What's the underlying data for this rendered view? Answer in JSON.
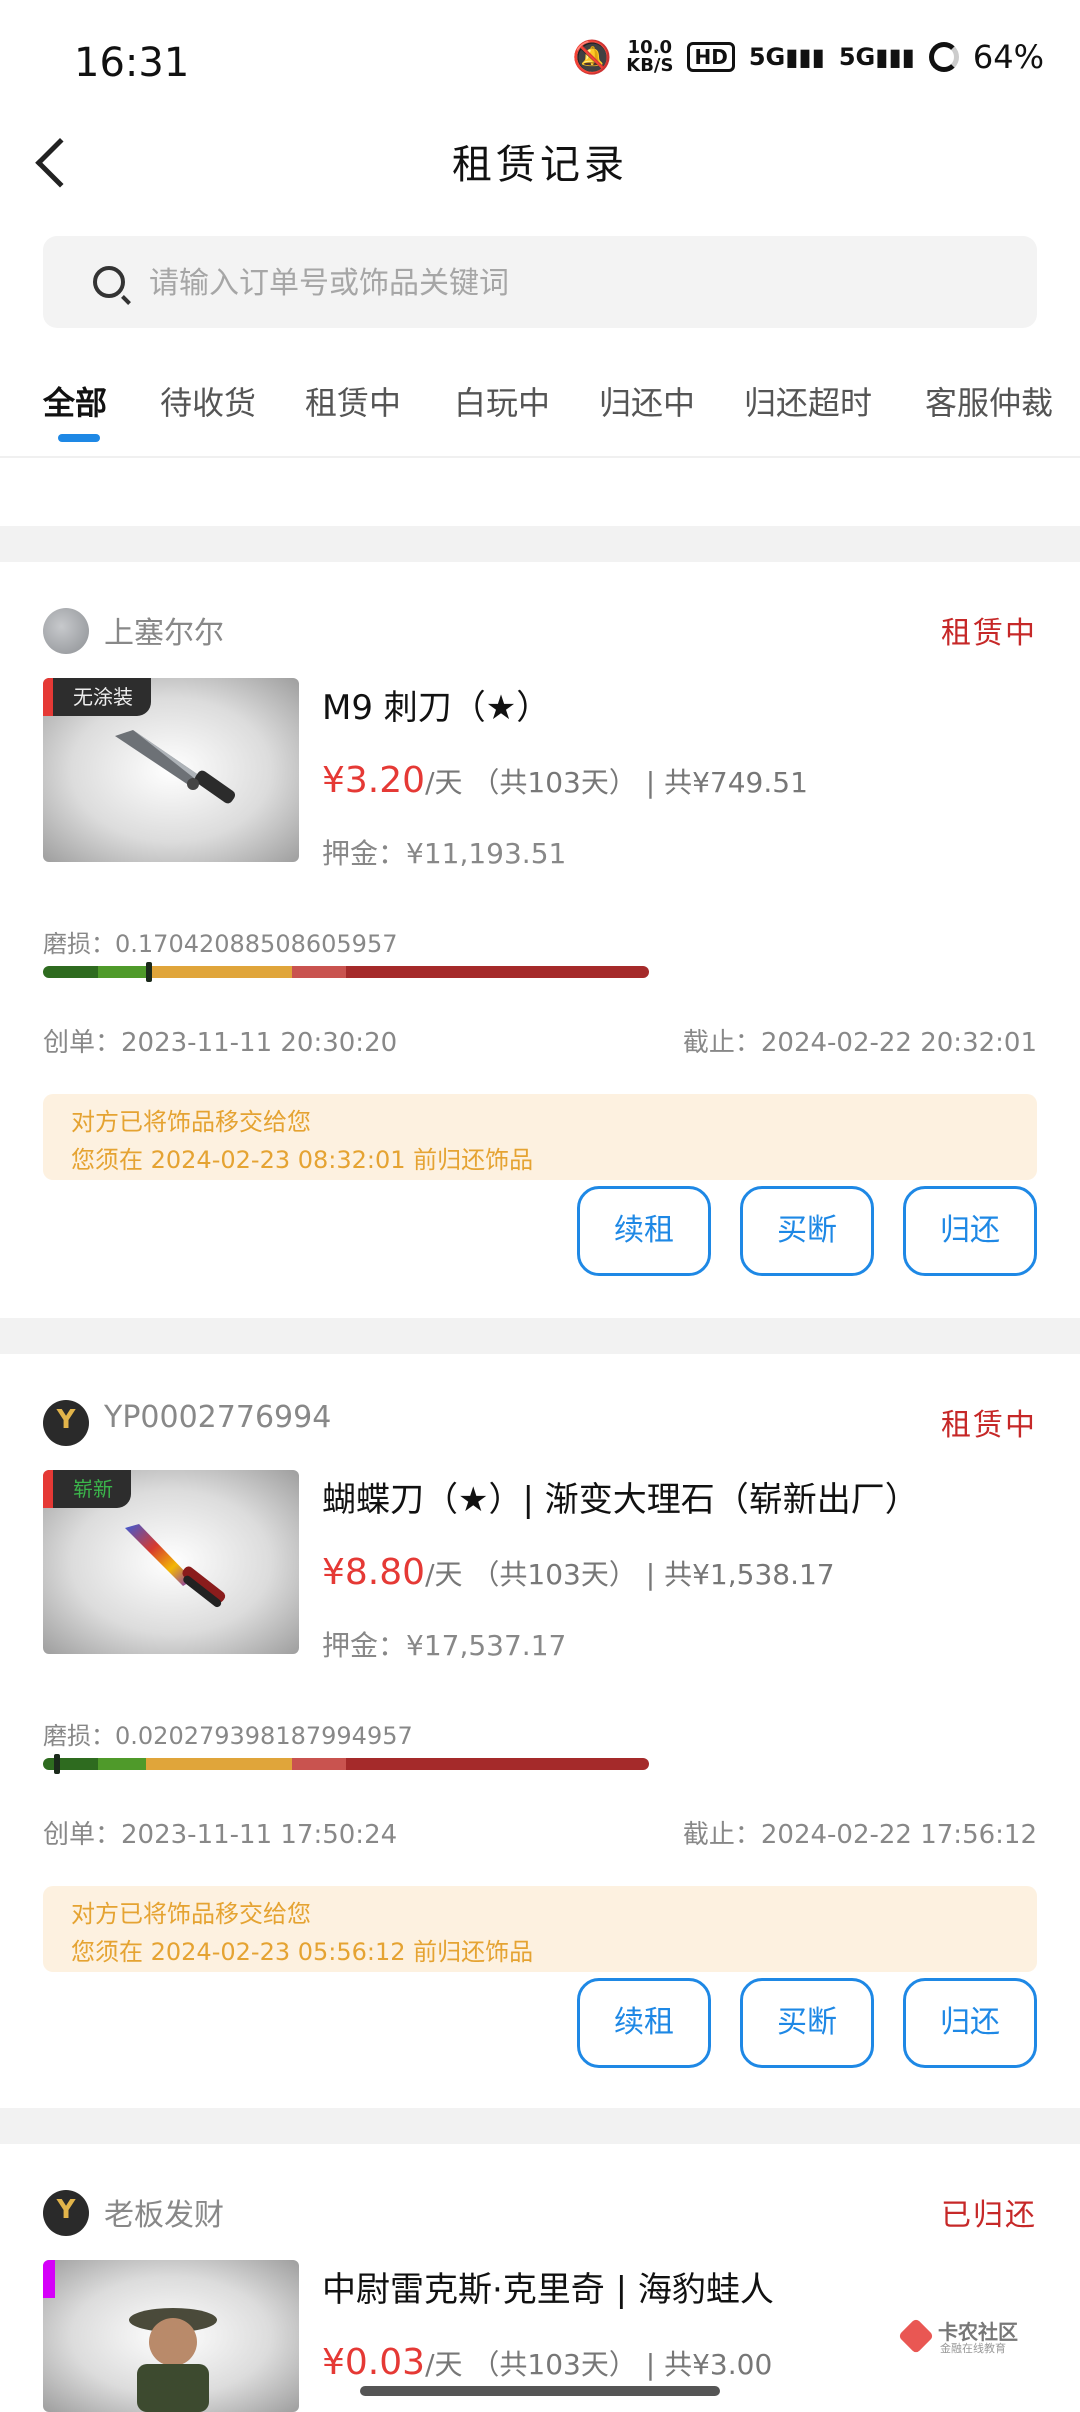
{
  "status_bar": {
    "time": "16:31",
    "net_speed_value": "10.0",
    "net_speed_unit": "KB/S",
    "hd": "HD",
    "signal1": "5G",
    "signal2": "5G",
    "battery": "64%"
  },
  "header": {
    "title": "租赁记录"
  },
  "search": {
    "placeholder": "请输入订单号或饰品关键词"
  },
  "tabs": [
    "全部",
    "待收货",
    "租赁中",
    "白玩中",
    "归还中",
    "归还超时",
    "客服仲裁"
  ],
  "active_tab": "全部",
  "orders": [
    {
      "seller": "上塞尔尔",
      "status": "租赁中",
      "wear_tag": "无涂装",
      "item_name": "M9 刺刀（★）",
      "price": "¥3.20",
      "price_unit": "/天",
      "days": "（共103天）",
      "separator": "|",
      "total": "共¥749.51",
      "deposit_label": "押金：",
      "deposit": "¥11,193.51",
      "float_label": "磨损：",
      "float": "0.17042088508605957",
      "created_label": "创单：",
      "created": "2023-11-11 20:30:20",
      "deadline_label": "截止：",
      "deadline": "2024-02-22 20:32:01",
      "notice_line1": "对方已将饰品移交给您",
      "notice_line2": "您须在 2024-02-23 08:32:01 前归还饰品",
      "buttons": {
        "renew": "续租",
        "buyout": "买断",
        "return": "归还"
      }
    },
    {
      "seller": "YP0002776994",
      "status": "租赁中",
      "wear_tag": "崭新",
      "item_name": "蝴蝶刀（★）| 渐变大理石（崭新出厂）",
      "price": "¥8.80",
      "price_unit": "/天",
      "days": "（共103天）",
      "separator": "|",
      "total": "共¥1,538.17",
      "deposit_label": "押金：",
      "deposit": "¥17,537.17",
      "float_label": "磨损：",
      "float": "0.020279398187994957",
      "created_label": "创单：",
      "created": "2023-11-11 17:50:24",
      "deadline_label": "截止：",
      "deadline": "2024-02-22 17:56:12",
      "notice_line1": "对方已将饰品移交给您",
      "notice_line2": "您须在 2024-02-23 05:56:12 前归还饰品",
      "buttons": {
        "renew": "续租",
        "buyout": "买断",
        "return": "归还"
      }
    },
    {
      "seller": "老板发财",
      "status": "已归还",
      "item_name": "中尉雷克斯·克里奇 | 海豹蛙人",
      "price": "¥0.03",
      "price_unit": "/天",
      "days": "（共103天）",
      "separator": "|",
      "total": "共¥3.00"
    }
  ],
  "wear_scale_colors": [
    "#2e6b1f",
    "#4f9a2a",
    "#e0a53a",
    "#c9534f",
    "#a52a2a"
  ],
  "watermark": {
    "title": "卡农社区",
    "subtitle": "金融在线教育"
  }
}
